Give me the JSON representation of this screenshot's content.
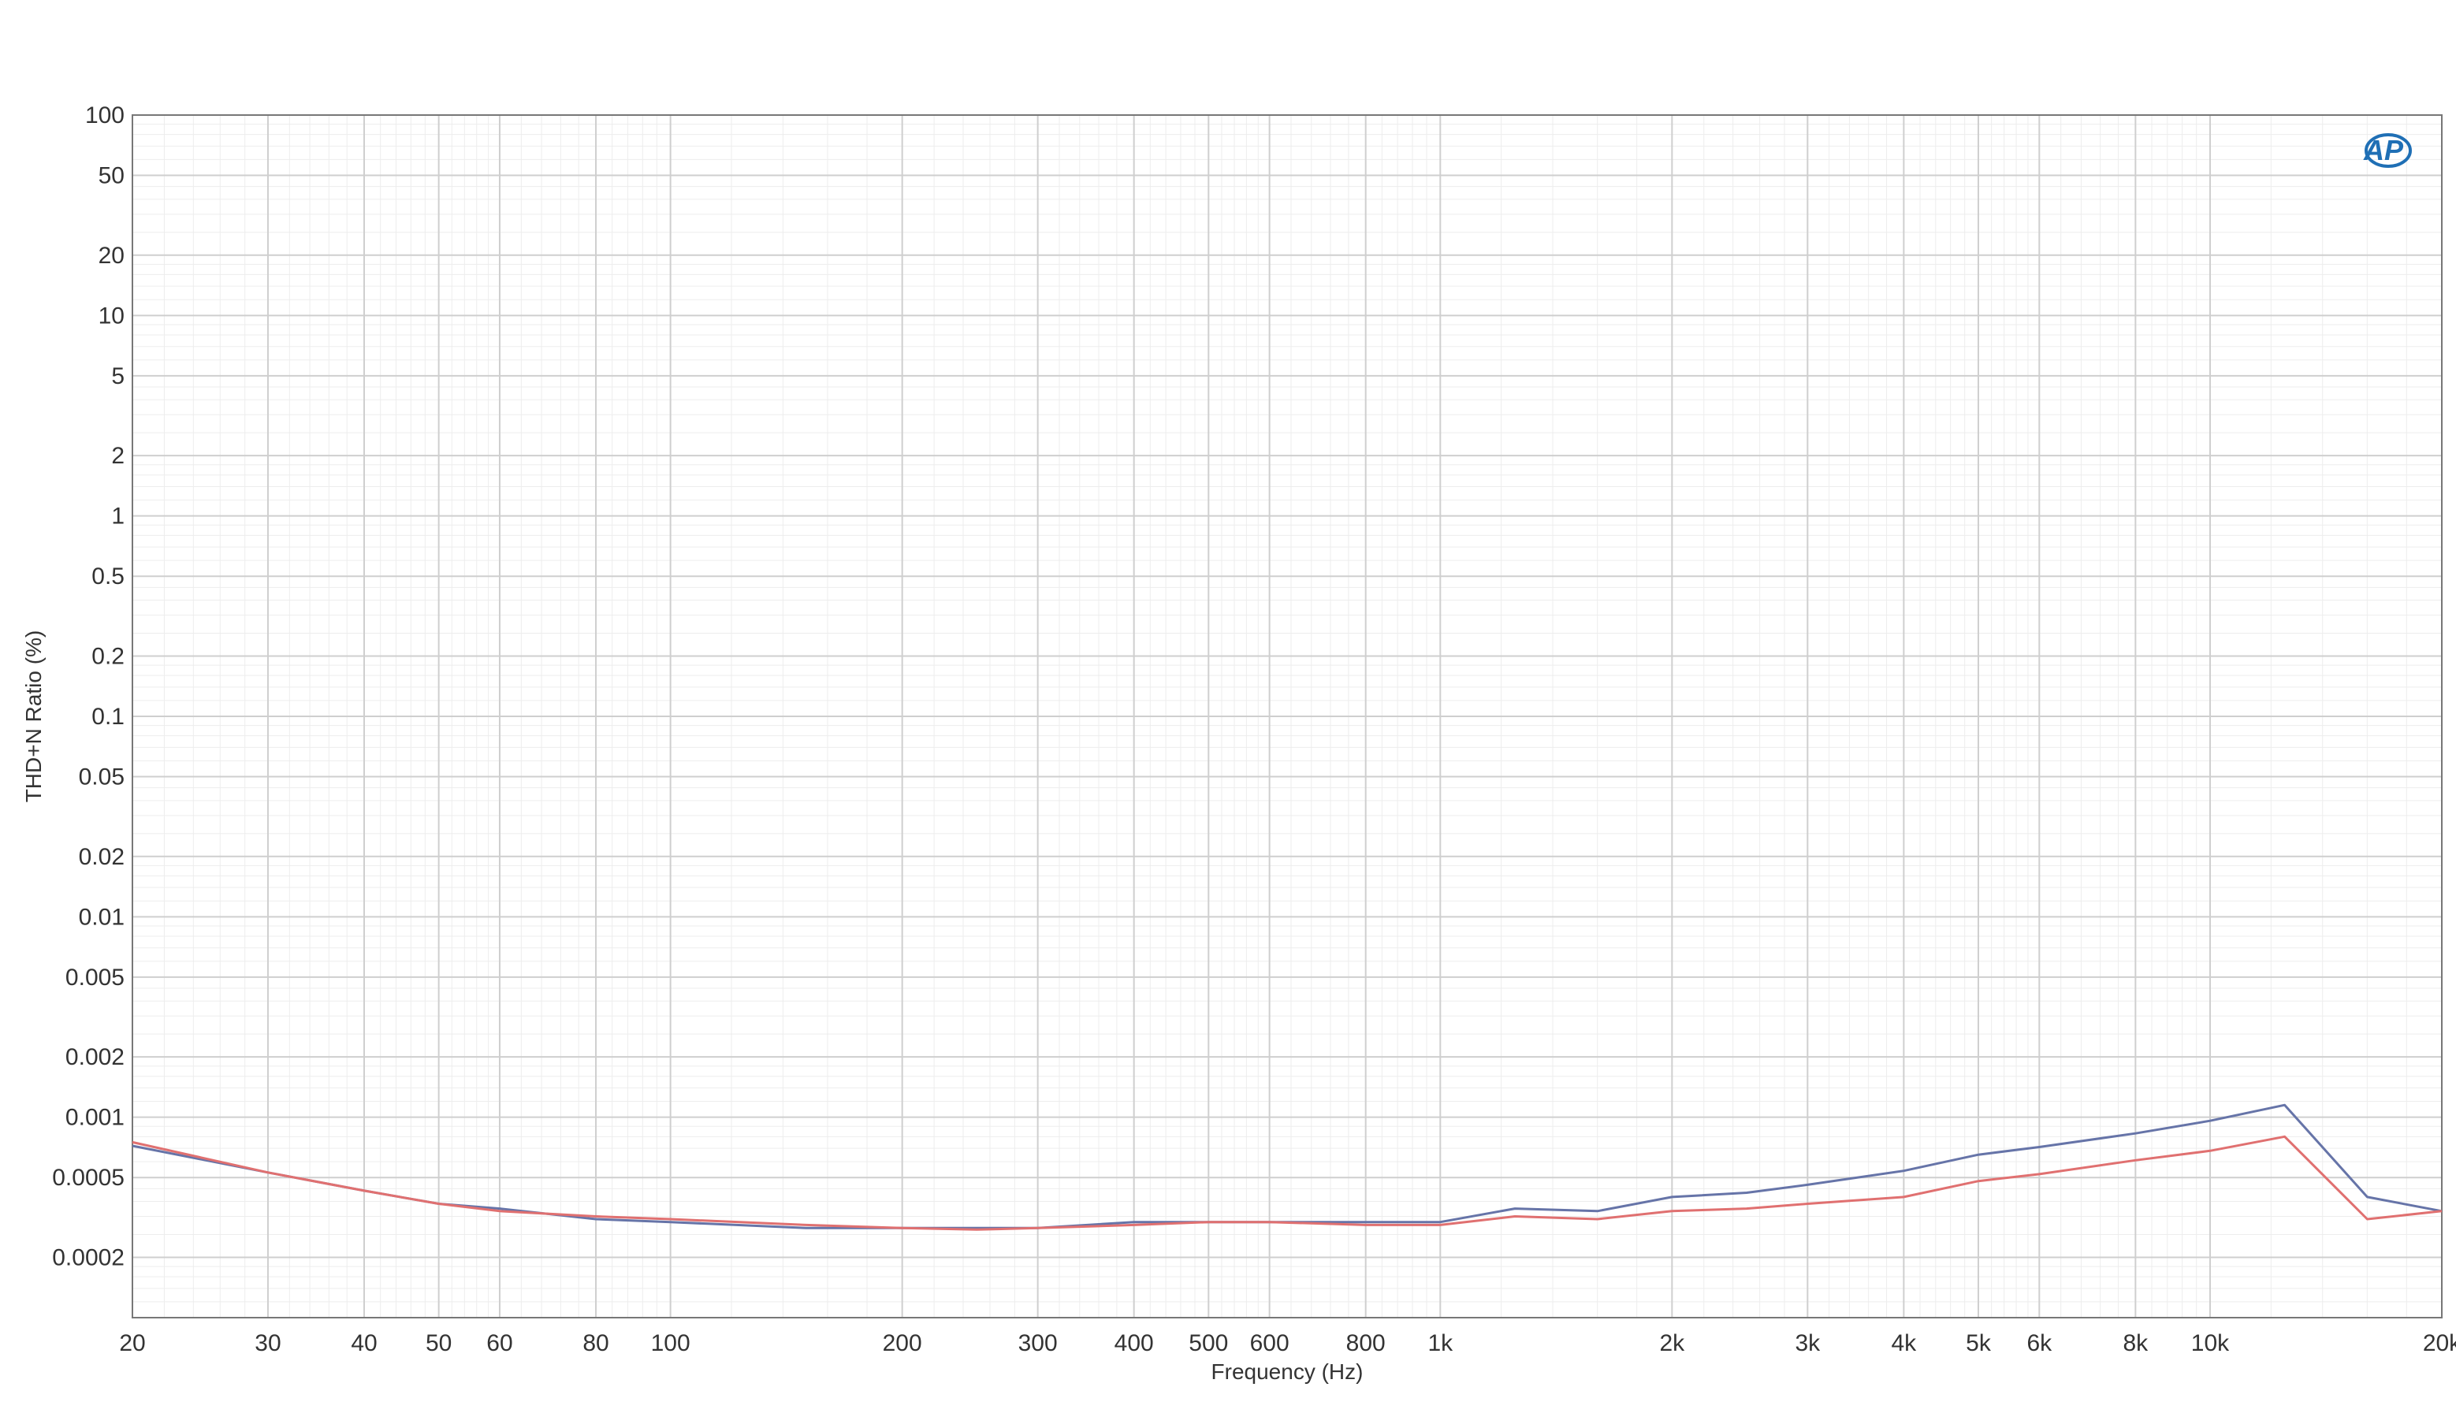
{
  "chart_data": {
    "type": "line",
    "title": "",
    "xlabel": "Frequency (Hz)",
    "ylabel": "THD+N Ratio (%)",
    "xscale": "log",
    "yscale": "log",
    "xlim": [
      20,
      20000
    ],
    "ylim": [
      0.0001,
      100
    ],
    "grid": true,
    "logo": "AP",
    "x_ticks": [
      {
        "value": 20,
        "label": "20"
      },
      {
        "value": 30,
        "label": "30"
      },
      {
        "value": 40,
        "label": "40"
      },
      {
        "value": 50,
        "label": "50"
      },
      {
        "value": 60,
        "label": "60"
      },
      {
        "value": 80,
        "label": "80"
      },
      {
        "value": 100,
        "label": "100"
      },
      {
        "value": 200,
        "label": "200"
      },
      {
        "value": 300,
        "label": "300"
      },
      {
        "value": 400,
        "label": "400"
      },
      {
        "value": 500,
        "label": "500"
      },
      {
        "value": 600,
        "label": "600"
      },
      {
        "value": 800,
        "label": "800"
      },
      {
        "value": 1000,
        "label": "1k"
      },
      {
        "value": 2000,
        "label": "2k"
      },
      {
        "value": 3000,
        "label": "3k"
      },
      {
        "value": 4000,
        "label": "4k"
      },
      {
        "value": 5000,
        "label": "5k"
      },
      {
        "value": 6000,
        "label": "6k"
      },
      {
        "value": 8000,
        "label": "8k"
      },
      {
        "value": 10000,
        "label": "10k"
      },
      {
        "value": 20000,
        "label": "20k"
      }
    ],
    "y_ticks": [
      {
        "value": 100,
        "label": "100"
      },
      {
        "value": 50,
        "label": "50"
      },
      {
        "value": 20,
        "label": "20"
      },
      {
        "value": 10,
        "label": "10"
      },
      {
        "value": 5,
        "label": "5"
      },
      {
        "value": 2,
        "label": "2"
      },
      {
        "value": 1,
        "label": "1"
      },
      {
        "value": 0.5,
        "label": "0.5"
      },
      {
        "value": 0.2,
        "label": "0.2"
      },
      {
        "value": 0.1,
        "label": "0.1"
      },
      {
        "value": 0.05,
        "label": "0.05"
      },
      {
        "value": 0.02,
        "label": "0.02"
      },
      {
        "value": 0.01,
        "label": "0.01"
      },
      {
        "value": 0.005,
        "label": "0.005"
      },
      {
        "value": 0.002,
        "label": "0.002"
      },
      {
        "value": 0.001,
        "label": "0.001"
      },
      {
        "value": 0.0005,
        "label": "0.0005"
      },
      {
        "value": 0.0002,
        "label": "0.0002"
      }
    ],
    "series": [
      {
        "color": "#6674a8",
        "x": [
          20,
          30,
          40,
          50,
          60,
          80,
          100,
          150,
          200,
          250,
          300,
          400,
          500,
          600,
          800,
          1000,
          1250,
          1600,
          2000,
          2500,
          3000,
          4000,
          5000,
          6000,
          8000,
          10000,
          12500,
          16000,
          20000
        ],
        "y": [
          0.00072,
          0.00053,
          0.00043,
          0.00037,
          0.00035,
          0.00031,
          0.0003,
          0.00028,
          0.00028,
          0.00028,
          0.00028,
          0.0003,
          0.0003,
          0.0003,
          0.0003,
          0.0003,
          0.00035,
          0.00034,
          0.0004,
          0.00042,
          0.00046,
          0.00054,
          0.00065,
          0.00071,
          0.00083,
          0.00096,
          0.00115,
          0.0004,
          0.00034
        ]
      },
      {
        "color": "#e07070",
        "x": [
          20,
          30,
          40,
          50,
          60,
          80,
          100,
          150,
          200,
          250,
          300,
          400,
          500,
          600,
          800,
          1000,
          1250,
          1600,
          2000,
          2500,
          3000,
          4000,
          5000,
          6000,
          8000,
          10000,
          12500,
          16000,
          20000
        ],
        "y": [
          0.00075,
          0.00053,
          0.00043,
          0.00037,
          0.00034,
          0.00032,
          0.00031,
          0.00029,
          0.00028,
          0.000275,
          0.00028,
          0.00029,
          0.0003,
          0.0003,
          0.00029,
          0.00029,
          0.00032,
          0.00031,
          0.00034,
          0.00035,
          0.00037,
          0.0004,
          0.00048,
          0.00052,
          0.00061,
          0.00068,
          0.0008,
          0.00031,
          0.00034
        ]
      }
    ]
  }
}
